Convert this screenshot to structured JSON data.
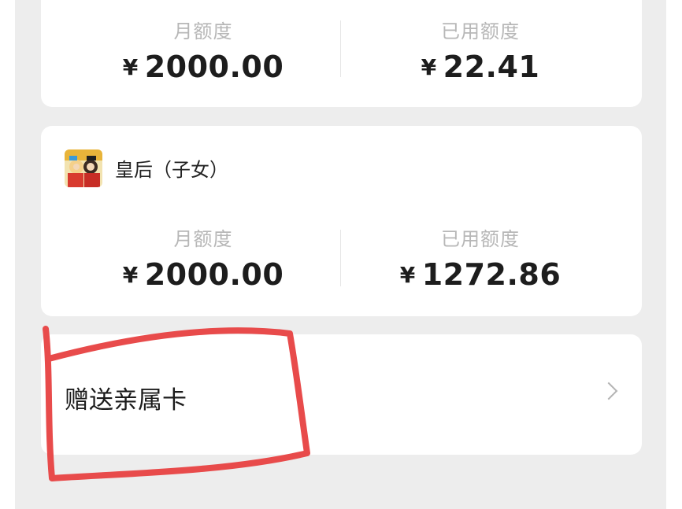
{
  "cards": [
    {
      "monthly_label": "月额度",
      "monthly_amount": "2000.00",
      "used_label": "已用额度",
      "used_amount": "22.41",
      "currency": "¥"
    },
    {
      "member_name": "皇后（子女）",
      "monthly_label": "月额度",
      "monthly_amount": "2000.00",
      "used_label": "已用额度",
      "used_amount": "1272.86",
      "currency": "¥"
    }
  ],
  "gift": {
    "label": "赠送亲属卡",
    "icon": "chevron-right-icon"
  },
  "colors": {
    "background": "#ededed",
    "card": "#ffffff",
    "annotation": "#e84b4b",
    "label": "#b7b7b7"
  }
}
